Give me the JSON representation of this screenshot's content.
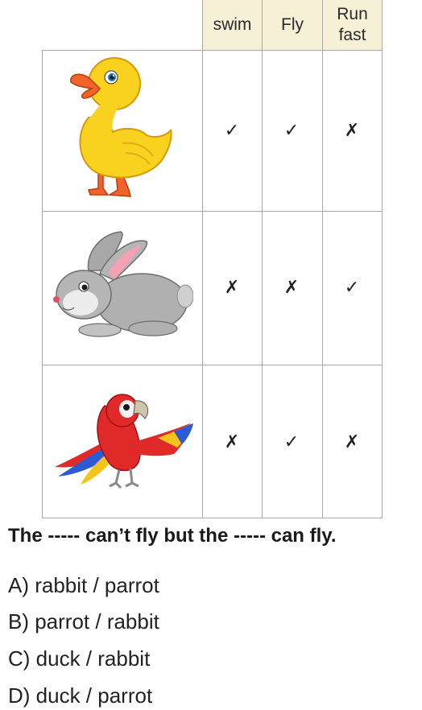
{
  "table": {
    "headers": [
      "swim",
      "Fly",
      "Run fast"
    ],
    "header_color": "#f6f1d6",
    "rows": [
      {
        "animal": "duck-image",
        "marks": [
          "✓",
          "✓",
          "✗"
        ]
      },
      {
        "animal": "rabbit-image",
        "marks": [
          "✗",
          "✗",
          "✓"
        ]
      },
      {
        "animal": "parrot-image",
        "marks": [
          "✗",
          "✓",
          "✗"
        ]
      }
    ]
  },
  "question": "The ----- can’t fly but the ----- can fly.",
  "options": [
    "A) rabbit / parrot",
    "B) parrot / rabbit",
    "C) duck / rabbit",
    "D) duck / parrot"
  ]
}
